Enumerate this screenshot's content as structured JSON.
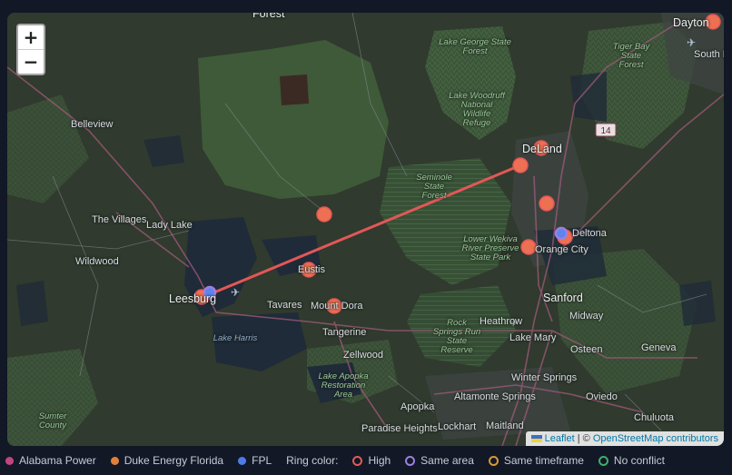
{
  "map": {
    "zoom_in": "+",
    "zoom_out": "−",
    "attribution": {
      "leaflet": "Leaflet",
      "separator": " | © ",
      "osm": "OpenStreetMap contributors"
    },
    "places": [
      {
        "name": "Forest",
        "cls": "big"
      },
      {
        "name": "Dayton",
        "cls": "big"
      },
      {
        "name": "South D",
        "cls": ""
      },
      {
        "name": "Belleview",
        "cls": ""
      },
      {
        "name": "DeLand",
        "cls": "big"
      },
      {
        "name": "The Villages",
        "cls": ""
      },
      {
        "name": "Lady Lake",
        "cls": ""
      },
      {
        "name": "Wildwood",
        "cls": ""
      },
      {
        "name": "Eustis",
        "cls": ""
      },
      {
        "name": "Leesburg",
        "cls": "big"
      },
      {
        "name": "Tavares",
        "cls": ""
      },
      {
        "name": "Mount Dora",
        "cls": ""
      },
      {
        "name": "Tangerine",
        "cls": ""
      },
      {
        "name": "Zellwood",
        "cls": ""
      },
      {
        "name": "Apopka",
        "cls": ""
      },
      {
        "name": "Sanford",
        "cls": "big"
      },
      {
        "name": "Deltona",
        "cls": ""
      },
      {
        "name": "Orange City",
        "cls": ""
      },
      {
        "name": "Midway",
        "cls": ""
      },
      {
        "name": "Heathrow",
        "cls": ""
      },
      {
        "name": "Lake Mary",
        "cls": ""
      },
      {
        "name": "Winter Springs",
        "cls": ""
      },
      {
        "name": "Altamonte Springs",
        "cls": ""
      },
      {
        "name": "Oviedo",
        "cls": ""
      },
      {
        "name": "Geneva",
        "cls": ""
      },
      {
        "name": "Chuluota",
        "cls": ""
      },
      {
        "name": "Paradise Heights",
        "cls": ""
      },
      {
        "name": "Lockhart",
        "cls": ""
      },
      {
        "name": "Maitland",
        "cls": ""
      },
      {
        "name": "Osteen",
        "cls": ""
      },
      {
        "name": "Sumter County",
        "cls": "green"
      },
      {
        "name": "Lake George State Forest",
        "cls": "green"
      },
      {
        "name": "Tiger Bay State Forest",
        "cls": "green"
      },
      {
        "name": "Lake Woodruff National Wildlife Refuge",
        "cls": "green"
      },
      {
        "name": "Seminole State Forest",
        "cls": "green"
      },
      {
        "name": "Lower Wekiva River Preserve State Park",
        "cls": "green"
      },
      {
        "name": "Rock Springs Run State Reserve",
        "cls": "green"
      },
      {
        "name": "Lake Apopka Restoration Area",
        "cls": "green"
      },
      {
        "name": "Lake Harris",
        "cls": "water"
      }
    ],
    "highway_shield": "14"
  },
  "legend": {
    "companies": [
      {
        "label": "Alabama Power",
        "color": "#c2457f"
      },
      {
        "label": "Duke Energy Florida",
        "color": "#e0803a"
      },
      {
        "label": "FPL",
        "color": "#4f7be6"
      }
    ],
    "ring_title": "Ring color:",
    "rings": [
      {
        "label": "High",
        "color": "#e25a5a"
      },
      {
        "label": "Same area",
        "color": "#9d7fe0"
      },
      {
        "label": "Same timeframe",
        "color": "#d99a33"
      },
      {
        "label": "No conflict",
        "color": "#3fae6a"
      }
    ]
  },
  "colors": {
    "duke_marker": "#ee7052",
    "fpl_marker": "#5b85f0",
    "conflict_line": "#e35757"
  }
}
